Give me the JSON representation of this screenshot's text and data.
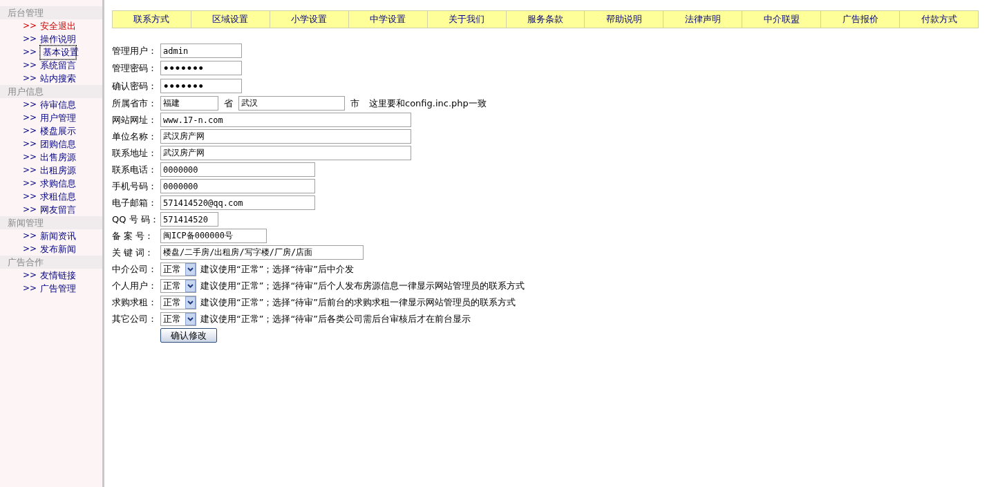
{
  "sidebar": {
    "groups": [
      {
        "title": "后台管理",
        "items": [
          {
            "label": "安全退出",
            "kind": "exit",
            "selected": false
          },
          {
            "label": "操作说明",
            "kind": "link",
            "selected": false
          },
          {
            "label": "基本设置",
            "kind": "link",
            "selected": true
          },
          {
            "label": "系统留言",
            "kind": "link",
            "selected": false
          },
          {
            "label": "站内搜索",
            "kind": "link",
            "selected": false
          }
        ]
      },
      {
        "title": "用户信息",
        "items": [
          {
            "label": "待审信息",
            "kind": "link",
            "selected": false
          },
          {
            "label": "用户管理",
            "kind": "link",
            "selected": false
          },
          {
            "label": "楼盘展示",
            "kind": "link",
            "selected": false
          },
          {
            "label": "团购信息",
            "kind": "link",
            "selected": false
          },
          {
            "label": "出售房源",
            "kind": "link",
            "selected": false
          },
          {
            "label": "出租房源",
            "kind": "link",
            "selected": false
          },
          {
            "label": "求购信息",
            "kind": "link",
            "selected": false
          },
          {
            "label": "求租信息",
            "kind": "link",
            "selected": false
          },
          {
            "label": "网友留言",
            "kind": "link",
            "selected": false
          }
        ]
      },
      {
        "title": "新闻管理",
        "items": [
          {
            "label": "新闻资讯",
            "kind": "link",
            "selected": false
          },
          {
            "label": "发布新闻",
            "kind": "link",
            "selected": false
          }
        ]
      },
      {
        "title": "广告合作",
        "items": [
          {
            "label": "友情链接",
            "kind": "link",
            "selected": false
          },
          {
            "label": "广告管理",
            "kind": "link",
            "selected": false
          }
        ]
      }
    ],
    "marker": ">>"
  },
  "tabs": [
    "联系方式",
    "区域设置",
    "小学设置",
    "中学设置",
    "关于我们",
    "服务条款",
    "帮助说明",
    "法律声明",
    "中介联盟",
    "广告报价",
    "付款方式"
  ],
  "form": {
    "rows": [
      {
        "kind": "text",
        "label": "管理用户：",
        "value": "admin"
      },
      {
        "kind": "password",
        "label": "管理密码：",
        "value": "•••••••"
      },
      {
        "kind": "password",
        "label": "确认密码：",
        "value": "•••••••"
      },
      {
        "kind": "city",
        "label": "所属省市：",
        "province": "福建",
        "province_suffix": "省",
        "city": "武汉",
        "city_suffix": "市",
        "note": "这里要和config.inc.php一致"
      },
      {
        "kind": "text",
        "label": "网站网址：",
        "value": "www.17-n.com"
      },
      {
        "kind": "text",
        "label": "单位名称：",
        "value": "武汉房产网"
      },
      {
        "kind": "text",
        "label": "联系地址：",
        "value": "武汉房产网"
      },
      {
        "kind": "text",
        "label": "联系电话：",
        "value": "0000000"
      },
      {
        "kind": "text",
        "label": "手机号码：",
        "value": "0000000"
      },
      {
        "kind": "text",
        "label": "电子邮箱：",
        "value": "571414520@qq.com"
      },
      {
        "kind": "text",
        "label": "QQ 号 码：",
        "value": "571414520"
      },
      {
        "kind": "text",
        "label": "备 案 号：",
        "value": "闽ICP备000000号"
      },
      {
        "kind": "text",
        "label": "关 键 词：",
        "value": "楼盘/二手房/出租房/写字楼/厂房/店面"
      },
      {
        "kind": "select",
        "label": "中介公司：",
        "value": "正常",
        "note": "建议使用“正常”；选择“待审”后中介发"
      },
      {
        "kind": "select",
        "label": "个人用户：",
        "value": "正常",
        "note": "建议使用“正常”；选择“待审”后个人发布房源信息一律显示网站管理员的联系方式"
      },
      {
        "kind": "select",
        "label": "求购求租：",
        "value": "正常",
        "note": "建议使用“正常”；选择“待审”后前台的求购求租一律显示网站管理员的联系方式"
      },
      {
        "kind": "select",
        "label": "其它公司：",
        "value": "正常",
        "note": "建议使用“正常”；选择“待审”后各类公司需后台审核后才在前台显示"
      }
    ],
    "submit": "确认修改"
  }
}
